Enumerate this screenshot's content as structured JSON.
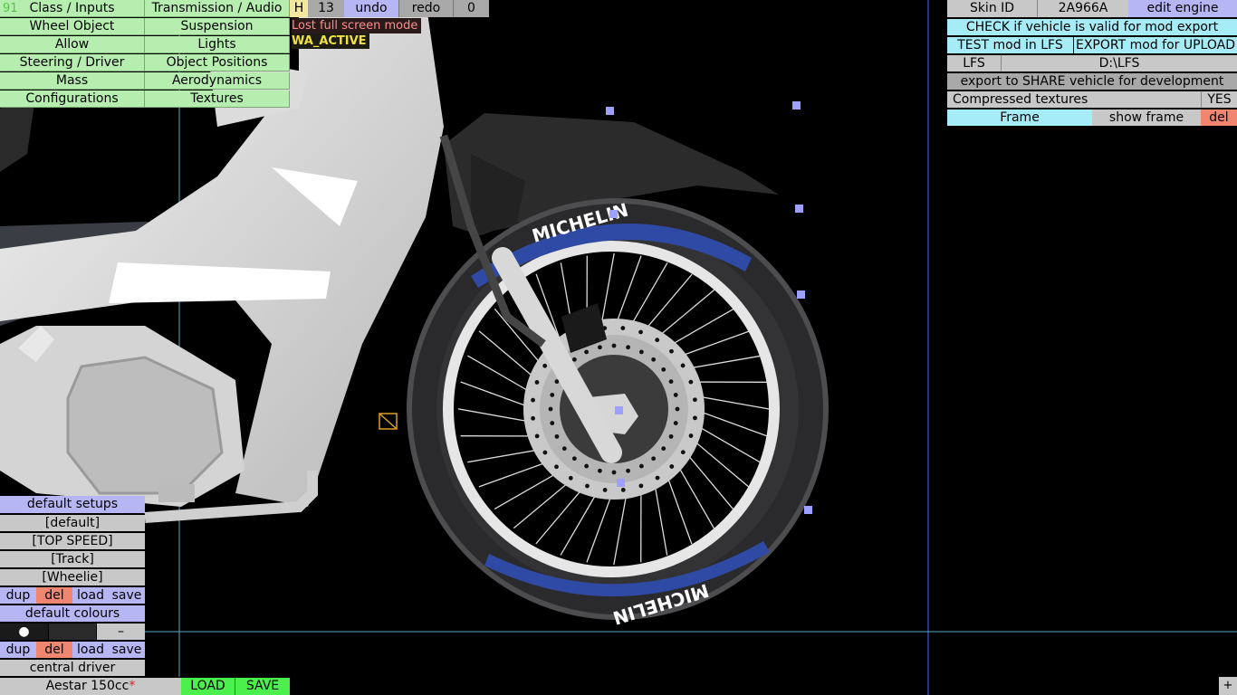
{
  "top_menu": {
    "fps": "91",
    "left_col": [
      "Class / Inputs",
      "Wheel Object",
      "Allow",
      "Steering / Driver",
      "Mass",
      "Configurations"
    ],
    "right_col": [
      "Transmission / Audio",
      "Suspension",
      "Lights",
      "Object Positions",
      "Aerodynamics",
      "Textures"
    ]
  },
  "toolbar": {
    "h_label": "H",
    "h_value": "13",
    "undo": "undo",
    "redo": "redo",
    "count": "0"
  },
  "status": {
    "warning": "Lost full screen mode",
    "wa_active": "WA_ACTIVE"
  },
  "right_panel": {
    "skin_label": "Skin ID",
    "skin_value": "2A966A",
    "edit_engine": "edit engine",
    "check": "CHECK if vehicle is valid for mod export",
    "test": "TEST mod in LFS",
    "export": "EXPORT mod for UPLOAD",
    "lfs_label": "LFS",
    "lfs_path": "D:\\LFS",
    "share": "export to SHARE vehicle for development",
    "compressed_label": "Compressed textures",
    "compressed_value": "YES",
    "frame": "Frame",
    "show_frame": "show frame",
    "del": "del"
  },
  "setups": {
    "header": "default setups",
    "items": [
      "[default]",
      "[TOP SPEED]",
      "[Track]",
      "[Wheelie]"
    ],
    "dup": "dup",
    "del": "del",
    "load": "load",
    "save": "save"
  },
  "colours": {
    "header": "default colours",
    "swatch_dot": "●",
    "swatch_dash": "–",
    "dup": "dup",
    "del": "del",
    "load": "load",
    "save": "save",
    "driver": "central driver"
  },
  "bottom": {
    "vehicle": "Aestar 150cc",
    "modified": "*",
    "load": "LOAD",
    "save": "SAVE",
    "plus": "+"
  },
  "viewport": {
    "tyre_brand": "MICHELIN"
  }
}
